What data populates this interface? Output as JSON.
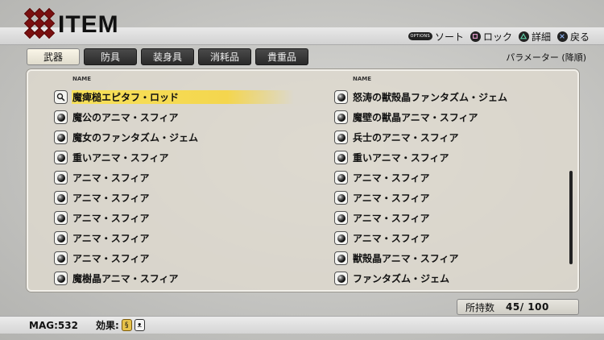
{
  "header": {
    "title": "ITEM",
    "help": [
      {
        "button": "OPTIONS",
        "icon": "options-button-icon",
        "label": "ソート"
      },
      {
        "button": "square",
        "icon": "square-button-icon",
        "label": "ロック"
      },
      {
        "button": "triangle",
        "icon": "triangle-button-icon",
        "label": "詳細"
      },
      {
        "button": "cross",
        "icon": "cross-button-icon",
        "label": "戻る"
      }
    ]
  },
  "tabs": [
    {
      "label": "武器",
      "active": true
    },
    {
      "label": "防具",
      "active": false
    },
    {
      "label": "装身具",
      "active": false
    },
    {
      "label": "消耗品",
      "active": false
    },
    {
      "label": "貴重品",
      "active": false
    }
  ],
  "sort_label": "パラメーター (降順)",
  "columns": {
    "left": {
      "header": "NAME",
      "items": [
        {
          "name": "魔痺槌エピタフ・ロッド",
          "icon": "magnifier-icon",
          "selected": true
        },
        {
          "name": "魔公のアニマ・スフィア",
          "icon": "orb-icon"
        },
        {
          "name": "魔女のファンタズム・ジェム",
          "icon": "orb-icon"
        },
        {
          "name": "重いアニマ・スフィア",
          "icon": "orb-icon"
        },
        {
          "name": "アニマ・スフィア",
          "icon": "orb-icon"
        },
        {
          "name": "アニマ・スフィア",
          "icon": "orb-icon"
        },
        {
          "name": "アニマ・スフィア",
          "icon": "orb-icon"
        },
        {
          "name": "アニマ・スフィア",
          "icon": "orb-icon"
        },
        {
          "name": "アニマ・スフィア",
          "icon": "orb-icon"
        },
        {
          "name": "魔樹晶アニマ・スフィア",
          "icon": "orb-icon"
        }
      ]
    },
    "right": {
      "header": "NAME",
      "items": [
        {
          "name": "怒涛の獣殻晶ファンタズム・ジェム",
          "icon": "orb-icon"
        },
        {
          "name": "魔壁の獣晶アニマ・スフィア",
          "icon": "orb-icon"
        },
        {
          "name": "兵士のアニマ・スフィア",
          "icon": "orb-icon"
        },
        {
          "name": "重いアニマ・スフィア",
          "icon": "orb-icon"
        },
        {
          "name": "アニマ・スフィア",
          "icon": "orb-icon"
        },
        {
          "name": "アニマ・スフィア",
          "icon": "orb-icon"
        },
        {
          "name": "アニマ・スフィア",
          "icon": "orb-icon"
        },
        {
          "name": "アニマ・スフィア",
          "icon": "orb-icon"
        },
        {
          "name": "獣殻晶アニマ・スフィア",
          "icon": "orb-icon"
        },
        {
          "name": "ファンタズム・ジェム",
          "icon": "orb-icon"
        }
      ]
    }
  },
  "count": {
    "label": "所持数",
    "value": "45/ 100"
  },
  "footer": {
    "mag": "MAG:532",
    "effect_label": "効果:",
    "effects": [
      {
        "icon": "coin-effect-icon",
        "glyph": "§"
      },
      {
        "icon": "mask-effect-icon",
        "glyph": "ᴥ"
      }
    ]
  }
}
